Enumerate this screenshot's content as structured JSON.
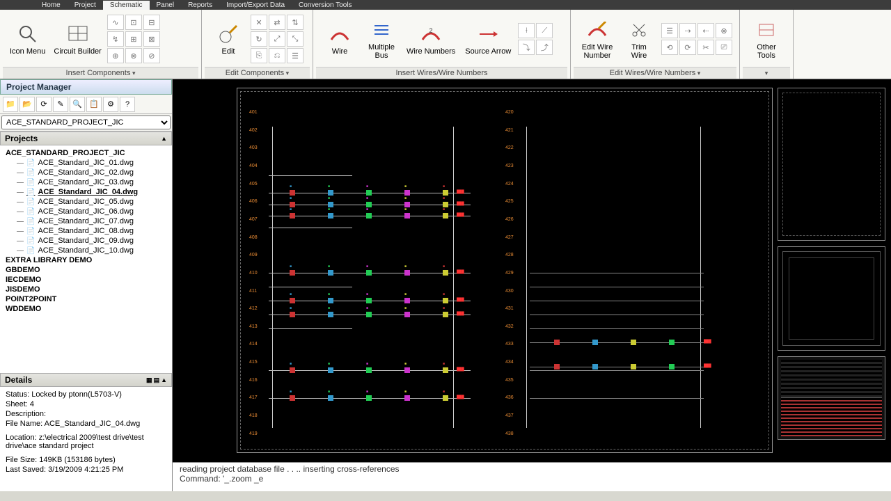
{
  "tabs": [
    "Home",
    "Project",
    "Schematic",
    "Panel",
    "Reports",
    "Import/Export Data",
    "Conversion Tools"
  ],
  "active_tab": "Schematic",
  "ribbon_groups": {
    "insert_components": {
      "label": "Insert Components",
      "icon_menu": "Icon Menu",
      "circuit_builder": "Circuit Builder"
    },
    "edit_components": {
      "label": "Edit Components",
      "edit": "Edit"
    },
    "insert_wires": {
      "label": "Insert Wires/Wire Numbers",
      "wire": "Wire",
      "multiple_bus": "Multiple\nBus",
      "wire_numbers": "Wire Numbers",
      "source_arrow": "Source Arrow"
    },
    "edit_wires": {
      "label": "Edit Wires/Wire Numbers",
      "edit_wire_number": "Edit Wire\nNumber",
      "trim_wire": "Trim\nWire"
    },
    "other": {
      "label": "",
      "other_tools": "Other\nTools"
    }
  },
  "project_manager": {
    "title": "Project Manager",
    "selected_project": "ACE_STANDARD_PROJECT_JIC",
    "projects_label": "Projects",
    "tree": [
      {
        "label": "ACE_STANDARD_PROJECT_JIC",
        "level": 0
      },
      {
        "label": "ACE_Standard_JIC_01.dwg",
        "level": 1
      },
      {
        "label": "ACE_Standard_JIC_02.dwg",
        "level": 1
      },
      {
        "label": "ACE_Standard_JIC_03.dwg",
        "level": 1
      },
      {
        "label": "ACE_Standard_JIC_04.dwg",
        "level": 1,
        "selected": true
      },
      {
        "label": "ACE_Standard_JIC_05.dwg",
        "level": 1
      },
      {
        "label": "ACE_Standard_JIC_06.dwg",
        "level": 1
      },
      {
        "label": "ACE_Standard_JIC_07.dwg",
        "level": 1
      },
      {
        "label": "ACE_Standard_JIC_08.dwg",
        "level": 1
      },
      {
        "label": "ACE_Standard_JIC_09.dwg",
        "level": 1
      },
      {
        "label": "ACE_Standard_JIC_10.dwg",
        "level": 1
      },
      {
        "label": "EXTRA LIBRARY DEMO",
        "level": 0
      },
      {
        "label": "GBDEMO",
        "level": 0
      },
      {
        "label": "IECDEMO",
        "level": 0
      },
      {
        "label": "JISDEMO",
        "level": 0
      },
      {
        "label": "POINT2POINT",
        "level": 0
      },
      {
        "label": "WDDEMO",
        "level": 0
      }
    ]
  },
  "details": {
    "title": "Details",
    "status": "Status: Locked by ptonn(L5703-V)",
    "sheet": "Sheet: 4",
    "description": "Description:",
    "filename": "File Name: ACE_Standard_JIC_04.dwg",
    "location": "Location: z:\\electrical 2009\\test drive\\test drive\\ace standard project",
    "filesize": "File Size: 149KB (153186 bytes)",
    "lastsaved": "Last Saved: 3/19/2009 4:21:25 PM"
  },
  "command": {
    "line1": "reading project database file . . .. inserting cross-references",
    "line2": "Command: '_.zoom _e"
  },
  "schematic": {
    "ladder_numbers_left": [
      "401",
      "402",
      "403",
      "404",
      "405",
      "406",
      "407",
      "408",
      "409",
      "410",
      "411",
      "412",
      "413",
      "414",
      "415",
      "416",
      "417",
      "418",
      "419"
    ],
    "ladder_numbers_right": [
      "420",
      "421",
      "422",
      "423",
      "424",
      "425",
      "426",
      "427",
      "428",
      "429",
      "430",
      "431",
      "432",
      "433",
      "434",
      "435",
      "436",
      "437",
      "438"
    ]
  }
}
